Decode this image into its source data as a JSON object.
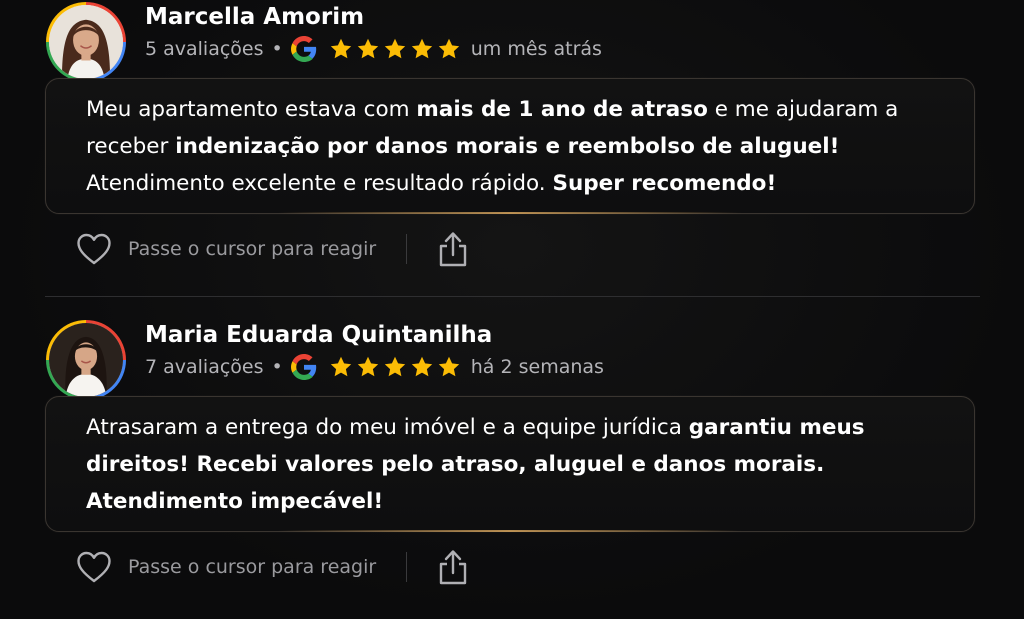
{
  "reviews": [
    {
      "name": "Marcella Amorim",
      "review_count": "5 avaliações",
      "separator": "•",
      "rating": 5,
      "time": "um mês atrás",
      "text": [
        {
          "t": "Meu apartamento estava com ",
          "b": false
        },
        {
          "t": "mais de 1 ano de atraso",
          "b": true
        },
        {
          "t": " e me ajudaram a receber ",
          "b": false
        },
        {
          "t": "indenização por danos morais e reembolso de aluguel!",
          "b": true
        },
        {
          "t": " Atendimento excelente e resultado rápido. ",
          "b": false
        },
        {
          "t": "Super recomendo!",
          "b": true
        }
      ],
      "react_label": "Passe o cursor para reagir"
    },
    {
      "name": "Maria Eduarda Quintanilha",
      "review_count": "7 avaliações",
      "separator": "•",
      "rating": 5,
      "time": "há 2 semanas",
      "text": [
        {
          "t": "Atrasaram a entrega do meu imóvel e a equipe jurídica ",
          "b": false
        },
        {
          "t": "garantiu meus direitos! Recebi valores pelo atraso, aluguel e danos morais. Atendimento impecável!",
          "b": true
        }
      ],
      "react_label": "Passe o cursor para reagir"
    }
  ],
  "icons": {
    "source": "google-g-icon",
    "star": "star-icon",
    "react": "heart-icon",
    "share": "share-icon"
  },
  "colors": {
    "star": "#fbbc05",
    "card_border": "#3a3530",
    "card_glow": "#d6a45c",
    "muted_text": "#b4b4b8"
  }
}
